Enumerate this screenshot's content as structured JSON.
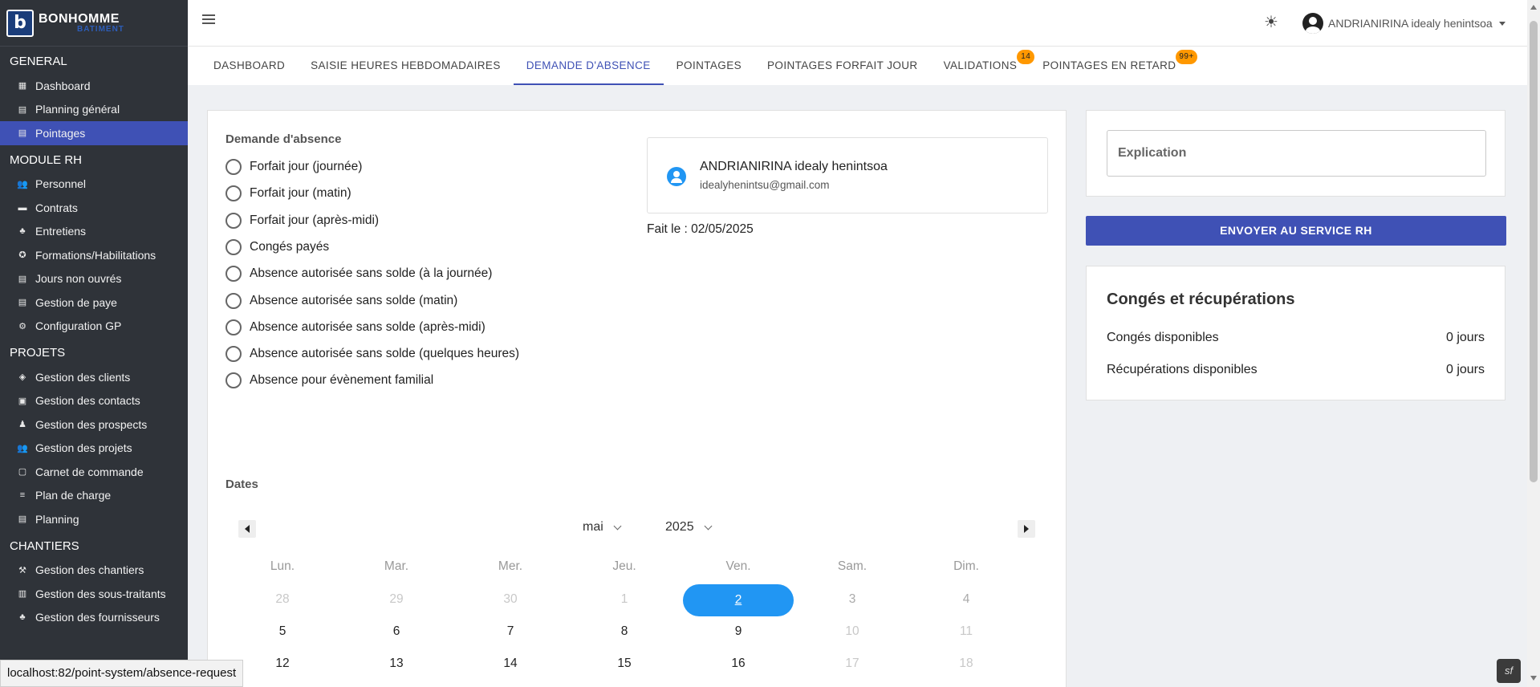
{
  "brand": {
    "name": "BONHOMME",
    "sub": "BATIMENT",
    "mark": "b"
  },
  "sidebar": {
    "sections": [
      {
        "title": "GENERAL",
        "items": [
          {
            "label": "Dashboard",
            "icon": "dashboard-icon",
            "glyph": "▦",
            "active": false
          },
          {
            "label": "Planning général",
            "icon": "calendar-icon",
            "glyph": "▤",
            "active": false
          },
          {
            "label": "Pointages",
            "icon": "calendar-icon",
            "glyph": "▤",
            "active": true
          }
        ]
      },
      {
        "title": "MODULE RH",
        "items": [
          {
            "label": "Personnel",
            "icon": "people-icon",
            "glyph": "👥",
            "active": false
          },
          {
            "label": "Contrats",
            "icon": "folder-icon",
            "glyph": "▬",
            "active": false
          },
          {
            "label": "Entretiens",
            "icon": "group-icon",
            "glyph": "♣",
            "active": false
          },
          {
            "label": "Formations/Habilitations",
            "icon": "badge-icon",
            "glyph": "✪",
            "active": false
          },
          {
            "label": "Jours non ouvrés",
            "icon": "calendar-icon",
            "glyph": "▤",
            "active": false
          },
          {
            "label": "Gestion de paye",
            "icon": "calendar-icon",
            "glyph": "▤",
            "active": false
          },
          {
            "label": "Configuration GP",
            "icon": "gear-icon",
            "glyph": "⚙",
            "active": false
          }
        ]
      },
      {
        "title": "PROJETS",
        "items": [
          {
            "label": "Gestion des clients",
            "icon": "layers-icon",
            "glyph": "◈",
            "active": false
          },
          {
            "label": "Gestion des contacts",
            "icon": "contact-icon",
            "glyph": "▣",
            "active": false
          },
          {
            "label": "Gestion des prospects",
            "icon": "person-search-icon",
            "glyph": "♟",
            "active": false
          },
          {
            "label": "Gestion des projets",
            "icon": "people-icon",
            "glyph": "👥",
            "active": false
          },
          {
            "label": "Carnet de commande",
            "icon": "calendar-icon",
            "glyph": "▢",
            "active": false
          },
          {
            "label": "Plan de charge",
            "icon": "list-icon",
            "glyph": "≡",
            "active": false
          },
          {
            "label": "Planning",
            "icon": "calendar-icon",
            "glyph": "▤",
            "active": false
          }
        ]
      },
      {
        "title": "CHANTIERS",
        "items": [
          {
            "label": "Gestion des chantiers",
            "icon": "worker-icon",
            "glyph": "⚒",
            "active": false
          },
          {
            "label": "Gestion des sous-traitants",
            "icon": "building-icon",
            "glyph": "▥",
            "active": false
          },
          {
            "label": "Gestion des fournisseurs",
            "icon": "group-icon",
            "glyph": "♣",
            "active": false
          }
        ]
      }
    ]
  },
  "topbar": {
    "user_name": "ANDRIANIRINA idealy henintsoa"
  },
  "tabs": [
    {
      "label": "DASHBOARD",
      "active": false,
      "badge": ""
    },
    {
      "label": "SAISIE HEURES HEBDOMADAIRES",
      "active": false,
      "badge": ""
    },
    {
      "label": "DEMANDE D'ABSENCE",
      "active": true,
      "badge": ""
    },
    {
      "label": "POINTAGES",
      "active": false,
      "badge": ""
    },
    {
      "label": "POINTAGES FORFAIT JOUR",
      "active": false,
      "badge": ""
    },
    {
      "label": "VALIDATIONS",
      "active": false,
      "badge": "14"
    },
    {
      "label": "POINTAGES EN RETARD",
      "active": false,
      "badge": "99+"
    }
  ],
  "form": {
    "title": "Demande d'absence",
    "options": [
      "Forfait jour (journée)",
      "Forfait jour (matin)",
      "Forfait jour (après-midi)",
      "Congés payés",
      "Absence autorisée sans solde (à la journée)",
      "Absence autorisée sans solde (matin)",
      "Absence autorisée sans solde (après-midi)",
      "Absence autorisée sans solde (quelques heures)",
      "Absence pour évènement familial"
    ],
    "dates_label": "Dates"
  },
  "user_card": {
    "name": "ANDRIANIRINA idealy henintsoa",
    "email": "idealyhenintsu@gmail.com",
    "made_on": "Fait le : 02/05/2025"
  },
  "calendar": {
    "month": "mai",
    "year": "2025",
    "weekdays": [
      "Lun.",
      "Mar.",
      "Mer.",
      "Jeu.",
      "Ven.",
      "Sam.",
      "Dim."
    ],
    "weeks": [
      [
        {
          "d": "28",
          "s": "muted"
        },
        {
          "d": "29",
          "s": "muted"
        },
        {
          "d": "30",
          "s": "muted"
        },
        {
          "d": "1",
          "s": "muted"
        },
        {
          "d": "2",
          "s": "selected"
        },
        {
          "d": "3",
          "s": "weekend"
        },
        {
          "d": "4",
          "s": "weekend"
        }
      ],
      [
        {
          "d": "5",
          "s": ""
        },
        {
          "d": "6",
          "s": ""
        },
        {
          "d": "7",
          "s": ""
        },
        {
          "d": "8",
          "s": ""
        },
        {
          "d": "9",
          "s": ""
        },
        {
          "d": "10",
          "s": "muted"
        },
        {
          "d": "11",
          "s": "muted"
        }
      ],
      [
        {
          "d": "12",
          "s": ""
        },
        {
          "d": "13",
          "s": ""
        },
        {
          "d": "14",
          "s": ""
        },
        {
          "d": "15",
          "s": ""
        },
        {
          "d": "16",
          "s": ""
        },
        {
          "d": "17",
          "s": "muted"
        },
        {
          "d": "18",
          "s": "muted"
        }
      ]
    ]
  },
  "explanation": {
    "placeholder": "Explication"
  },
  "send_button": "ENVOYER AU SERVICE RH",
  "leave": {
    "title": "Congés et récupérations",
    "rows": [
      {
        "label": "Congés disponibles",
        "value": "0 jours"
      },
      {
        "label": "Récupérations disponibles",
        "value": "0 jours"
      }
    ]
  },
  "status_bar": "localhost:82/point-system/absence-request",
  "symfony_badge": "sf",
  "colors": {
    "primary": "#3f51b5",
    "accent": "#2196f3",
    "badge": "#ff9800",
    "sidebar": "#2f3339"
  }
}
